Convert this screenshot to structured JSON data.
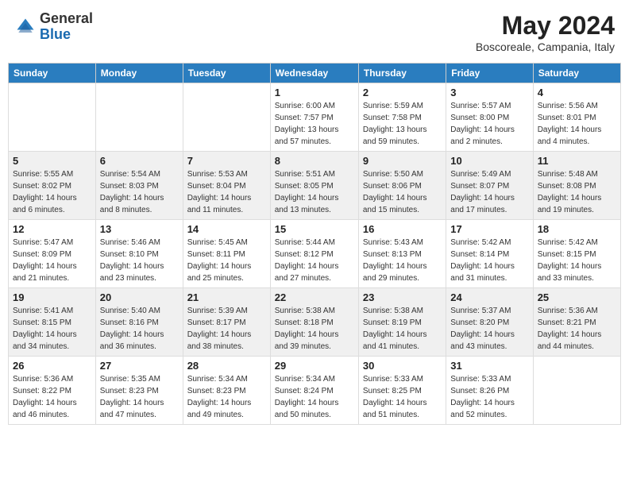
{
  "header": {
    "logo_general": "General",
    "logo_blue": "Blue",
    "month_title": "May 2024",
    "location": "Boscoreale, Campania, Italy"
  },
  "days_of_week": [
    "Sunday",
    "Monday",
    "Tuesday",
    "Wednesday",
    "Thursday",
    "Friday",
    "Saturday"
  ],
  "weeks": [
    [
      {
        "day": "",
        "info": ""
      },
      {
        "day": "",
        "info": ""
      },
      {
        "day": "",
        "info": ""
      },
      {
        "day": "1",
        "info": "Sunrise: 6:00 AM\nSunset: 7:57 PM\nDaylight: 13 hours\nand 57 minutes."
      },
      {
        "day": "2",
        "info": "Sunrise: 5:59 AM\nSunset: 7:58 PM\nDaylight: 13 hours\nand 59 minutes."
      },
      {
        "day": "3",
        "info": "Sunrise: 5:57 AM\nSunset: 8:00 PM\nDaylight: 14 hours\nand 2 minutes."
      },
      {
        "day": "4",
        "info": "Sunrise: 5:56 AM\nSunset: 8:01 PM\nDaylight: 14 hours\nand 4 minutes."
      }
    ],
    [
      {
        "day": "5",
        "info": "Sunrise: 5:55 AM\nSunset: 8:02 PM\nDaylight: 14 hours\nand 6 minutes."
      },
      {
        "day": "6",
        "info": "Sunrise: 5:54 AM\nSunset: 8:03 PM\nDaylight: 14 hours\nand 8 minutes."
      },
      {
        "day": "7",
        "info": "Sunrise: 5:53 AM\nSunset: 8:04 PM\nDaylight: 14 hours\nand 11 minutes."
      },
      {
        "day": "8",
        "info": "Sunrise: 5:51 AM\nSunset: 8:05 PM\nDaylight: 14 hours\nand 13 minutes."
      },
      {
        "day": "9",
        "info": "Sunrise: 5:50 AM\nSunset: 8:06 PM\nDaylight: 14 hours\nand 15 minutes."
      },
      {
        "day": "10",
        "info": "Sunrise: 5:49 AM\nSunset: 8:07 PM\nDaylight: 14 hours\nand 17 minutes."
      },
      {
        "day": "11",
        "info": "Sunrise: 5:48 AM\nSunset: 8:08 PM\nDaylight: 14 hours\nand 19 minutes."
      }
    ],
    [
      {
        "day": "12",
        "info": "Sunrise: 5:47 AM\nSunset: 8:09 PM\nDaylight: 14 hours\nand 21 minutes."
      },
      {
        "day": "13",
        "info": "Sunrise: 5:46 AM\nSunset: 8:10 PM\nDaylight: 14 hours\nand 23 minutes."
      },
      {
        "day": "14",
        "info": "Sunrise: 5:45 AM\nSunset: 8:11 PM\nDaylight: 14 hours\nand 25 minutes."
      },
      {
        "day": "15",
        "info": "Sunrise: 5:44 AM\nSunset: 8:12 PM\nDaylight: 14 hours\nand 27 minutes."
      },
      {
        "day": "16",
        "info": "Sunrise: 5:43 AM\nSunset: 8:13 PM\nDaylight: 14 hours\nand 29 minutes."
      },
      {
        "day": "17",
        "info": "Sunrise: 5:42 AM\nSunset: 8:14 PM\nDaylight: 14 hours\nand 31 minutes."
      },
      {
        "day": "18",
        "info": "Sunrise: 5:42 AM\nSunset: 8:15 PM\nDaylight: 14 hours\nand 33 minutes."
      }
    ],
    [
      {
        "day": "19",
        "info": "Sunrise: 5:41 AM\nSunset: 8:15 PM\nDaylight: 14 hours\nand 34 minutes."
      },
      {
        "day": "20",
        "info": "Sunrise: 5:40 AM\nSunset: 8:16 PM\nDaylight: 14 hours\nand 36 minutes."
      },
      {
        "day": "21",
        "info": "Sunrise: 5:39 AM\nSunset: 8:17 PM\nDaylight: 14 hours\nand 38 minutes."
      },
      {
        "day": "22",
        "info": "Sunrise: 5:38 AM\nSunset: 8:18 PM\nDaylight: 14 hours\nand 39 minutes."
      },
      {
        "day": "23",
        "info": "Sunrise: 5:38 AM\nSunset: 8:19 PM\nDaylight: 14 hours\nand 41 minutes."
      },
      {
        "day": "24",
        "info": "Sunrise: 5:37 AM\nSunset: 8:20 PM\nDaylight: 14 hours\nand 43 minutes."
      },
      {
        "day": "25",
        "info": "Sunrise: 5:36 AM\nSunset: 8:21 PM\nDaylight: 14 hours\nand 44 minutes."
      }
    ],
    [
      {
        "day": "26",
        "info": "Sunrise: 5:36 AM\nSunset: 8:22 PM\nDaylight: 14 hours\nand 46 minutes."
      },
      {
        "day": "27",
        "info": "Sunrise: 5:35 AM\nSunset: 8:23 PM\nDaylight: 14 hours\nand 47 minutes."
      },
      {
        "day": "28",
        "info": "Sunrise: 5:34 AM\nSunset: 8:23 PM\nDaylight: 14 hours\nand 49 minutes."
      },
      {
        "day": "29",
        "info": "Sunrise: 5:34 AM\nSunset: 8:24 PM\nDaylight: 14 hours\nand 50 minutes."
      },
      {
        "day": "30",
        "info": "Sunrise: 5:33 AM\nSunset: 8:25 PM\nDaylight: 14 hours\nand 51 minutes."
      },
      {
        "day": "31",
        "info": "Sunrise: 5:33 AM\nSunset: 8:26 PM\nDaylight: 14 hours\nand 52 minutes."
      },
      {
        "day": "",
        "info": ""
      }
    ]
  ]
}
